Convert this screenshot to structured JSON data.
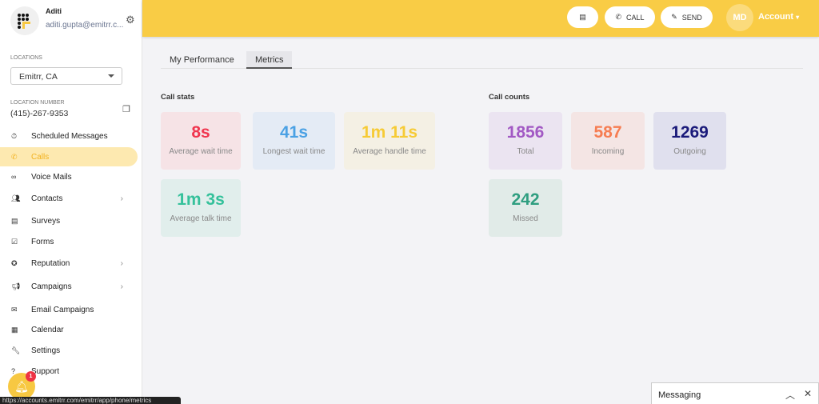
{
  "user": {
    "name": "Aditi",
    "email": "aditi.gupta@emitrr.c..."
  },
  "locations": {
    "label": "LOCATIONS",
    "selected": "Emitrr, CA"
  },
  "location_number": {
    "label": "LOCATION NUMBER",
    "value": "(415)-267-9353"
  },
  "nav": [
    {
      "label": "Scheduled Messages",
      "icon": "timer-icon"
    },
    {
      "label": "Calls",
      "icon": "phone-icon",
      "active": true
    },
    {
      "label": "Voice Mails",
      "icon": "voicemail-icon"
    },
    {
      "label": "Contacts",
      "icon": "contacts-icon",
      "chevron": true
    },
    {
      "label": "Surveys",
      "icon": "document-icon"
    },
    {
      "label": "Forms",
      "icon": "form-icon"
    },
    {
      "label": "Reputation",
      "icon": "star-icon",
      "chevron": true
    },
    {
      "label": "Campaigns",
      "icon": "megaphone-icon",
      "chevron": true
    },
    {
      "label": "Email Campaigns",
      "icon": "mail-icon"
    },
    {
      "label": "Calendar",
      "icon": "calendar-icon"
    },
    {
      "label": "Settings",
      "icon": "wrench-icon"
    },
    {
      "label": "Support",
      "icon": "help-icon"
    }
  ],
  "header": {
    "call_label": "CALL",
    "send_label": "SEND",
    "initials": "MD",
    "account_label": "Account"
  },
  "tabs": [
    {
      "label": "My Performance"
    },
    {
      "label": "Metrics",
      "active": true
    }
  ],
  "call_stats": {
    "title": "Call stats",
    "cards": [
      {
        "value": "8s",
        "label": "Average wait time",
        "color": "#f0364f",
        "bg": "#f6e3e6"
      },
      {
        "value": "41s",
        "label": "Longest wait time",
        "color": "#4ba1e4",
        "bg": "#e4ebf5"
      },
      {
        "value": "1m 11s",
        "label": "Average handle time",
        "color": "#f6cb36",
        "bg": "#f4f0e4"
      },
      {
        "value": "1m 3s",
        "label": "Average talk time",
        "color": "#35c19b",
        "bg": "#e1eeec"
      }
    ]
  },
  "call_counts": {
    "title": "Call counts",
    "cards": [
      {
        "value": "1856",
        "label": "Total",
        "color": "#a259c4",
        "bg": "#ebe4f1"
      },
      {
        "value": "587",
        "label": "Incoming",
        "color": "#f67d52",
        "bg": "#f4e5e4"
      },
      {
        "value": "1269",
        "label": "Outgoing",
        "color": "#1a1a7a",
        "bg": "#e0e0ee"
      },
      {
        "value": "242",
        "label": "Missed",
        "color": "#2f9e80",
        "bg": "#e1ebe8"
      }
    ]
  },
  "notifications": {
    "count": "1"
  },
  "messaging": {
    "label": "Messaging"
  },
  "status_url": "https://accounts.emitrr.com/emitrr/app/phone/metrics"
}
